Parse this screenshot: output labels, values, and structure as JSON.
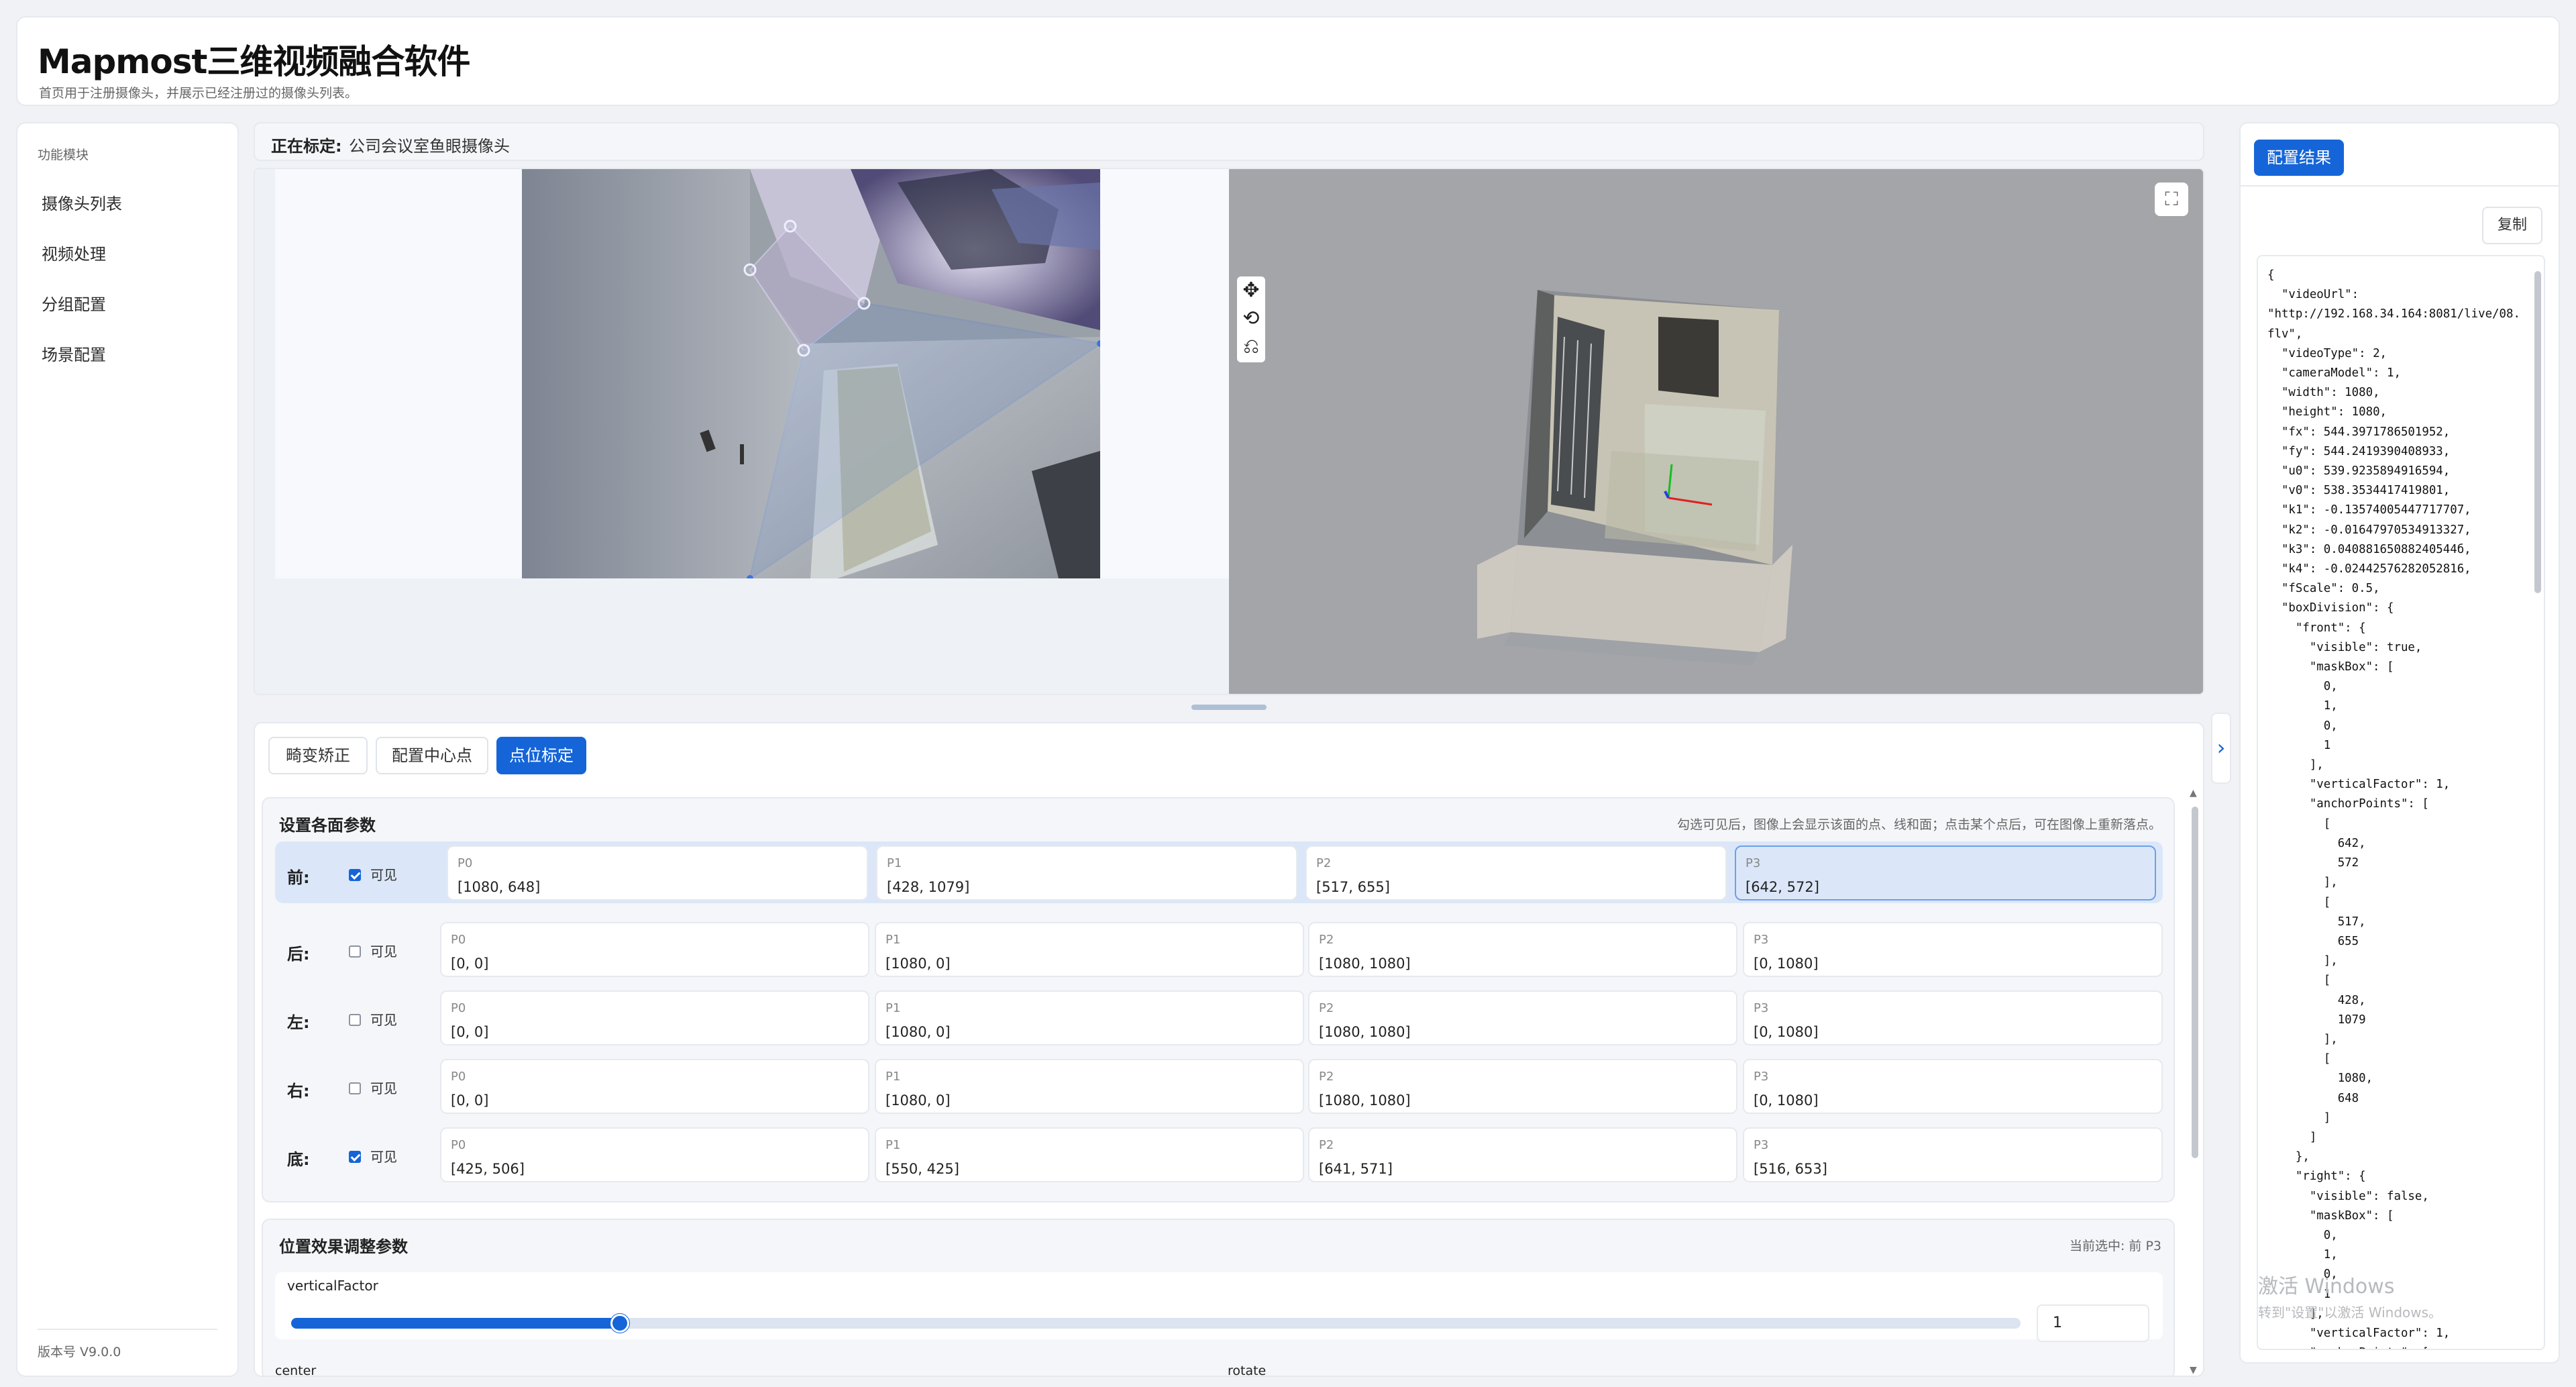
{
  "header": {
    "title": "Mapmost三维视频融合软件",
    "subtitle": "首页用于注册摄像头，并展示已经注册过的摄像头列表。"
  },
  "sidebar": {
    "title": "功能模块",
    "items": [
      {
        "label": "摄像头列表"
      },
      {
        "label": "视频处理"
      },
      {
        "label": "分组配置"
      },
      {
        "label": "场景配置"
      }
    ],
    "version": "版本号 V9.0.0"
  },
  "calibration": {
    "label": "正在标定:",
    "camera_name": "公司会议室鱼眼摄像头"
  },
  "viewer": {
    "fullscreen_icon": "expand-icon",
    "tools": [
      "move-icon",
      "rotate-icon",
      "reset-icon"
    ]
  },
  "tabs": [
    {
      "label": "畸变矫正",
      "active": false
    },
    {
      "label": "配置中心点",
      "active": false
    },
    {
      "label": "点位标定",
      "active": true
    }
  ],
  "faces_card": {
    "title": "设置各面参数",
    "hint": "勾选可见后，图像上会显示该面的点、线和面；点击某个点后，可在图像上重新落点。",
    "visible_label": "可见",
    "rows": [
      {
        "label": "前:",
        "visible": true,
        "points": [
          {
            "name": "P0",
            "value": "[1080, 648]"
          },
          {
            "name": "P1",
            "value": "[428, 1079]"
          },
          {
            "name": "P2",
            "value": "[517, 655]"
          },
          {
            "name": "P3",
            "value": "[642, 572]"
          }
        ]
      },
      {
        "label": "后:",
        "visible": false,
        "points": [
          {
            "name": "P0",
            "value": "[0, 0]"
          },
          {
            "name": "P1",
            "value": "[1080, 0]"
          },
          {
            "name": "P2",
            "value": "[1080, 1080]"
          },
          {
            "name": "P3",
            "value": "[0, 1080]"
          }
        ]
      },
      {
        "label": "左:",
        "visible": false,
        "points": [
          {
            "name": "P0",
            "value": "[0, 0]"
          },
          {
            "name": "P1",
            "value": "[1080, 0]"
          },
          {
            "name": "P2",
            "value": "[1080, 1080]"
          },
          {
            "name": "P3",
            "value": "[0, 1080]"
          }
        ]
      },
      {
        "label": "右:",
        "visible": false,
        "points": [
          {
            "name": "P0",
            "value": "[0, 0]"
          },
          {
            "name": "P1",
            "value": "[1080, 0]"
          },
          {
            "name": "P2",
            "value": "[1080, 1080]"
          },
          {
            "name": "P3",
            "value": "[0, 1080]"
          }
        ]
      },
      {
        "label": "底:",
        "visible": true,
        "points": [
          {
            "name": "P0",
            "value": "[425, 506]"
          },
          {
            "name": "P1",
            "value": "[550, 425]"
          },
          {
            "name": "P2",
            "value": "[641, 571]"
          },
          {
            "name": "P3",
            "value": "[516, 653]"
          }
        ]
      }
    ]
  },
  "position_card": {
    "title": "位置效果调整参数",
    "current": "当前选中: 前 P3",
    "slider_label": "verticalFactor",
    "slider_value": "1",
    "slider_fraction": 0.19,
    "center_label": "center",
    "rotate_label": "rotate"
  },
  "config_panel": {
    "tab_label": "配置结果",
    "copy_label": "复制",
    "json_text": "{\n  \"videoUrl\":\n\"http://192.168.34.164:8081/live/08.flv\",\n  \"videoType\": 2,\n  \"cameraModel\": 1,\n  \"width\": 1080,\n  \"height\": 1080,\n  \"fx\": 544.3971786501952,\n  \"fy\": 544.2419390408933,\n  \"u0\": 539.9235894916594,\n  \"v0\": 538.3534417419801,\n  \"k1\": -0.13574005447717707,\n  \"k2\": -0.01647970534913327,\n  \"k3\": 0.04088165088240544б,\n  \"k4\": -0.02442576282052816,\n  \"fScale\": 0.5,\n  \"boxDivision\": {\n    \"front\": {\n      \"visible\": true,\n      \"maskBox\": [\n        0,\n        1,\n        0,\n        1\n      ],\n      \"verticalFactor\": 1,\n      \"anchorPoints\": [\n        [\n          642,\n          572\n        ],\n        [\n          517,\n          655\n        ],\n        [\n          428,\n          1079\n        ],\n        [\n          1080,\n          648\n        ]\n      ]\n    },\n    \"right\": {\n      \"visible\": false,\n      \"maskBox\": [\n        0,\n        1,\n        0,\n        1\n      ],\n      \"verticalFactor\": 1,\n      \"anchorPoints\": ["
  },
  "watermark": {
    "line1": "激活 Windows",
    "line2": "转到\"设置\"以激活 Windows。"
  },
  "colors": {
    "accent": "#1565d8",
    "selected_row": "#dbe7f8",
    "viewer_grey": "#a3a5a8"
  }
}
